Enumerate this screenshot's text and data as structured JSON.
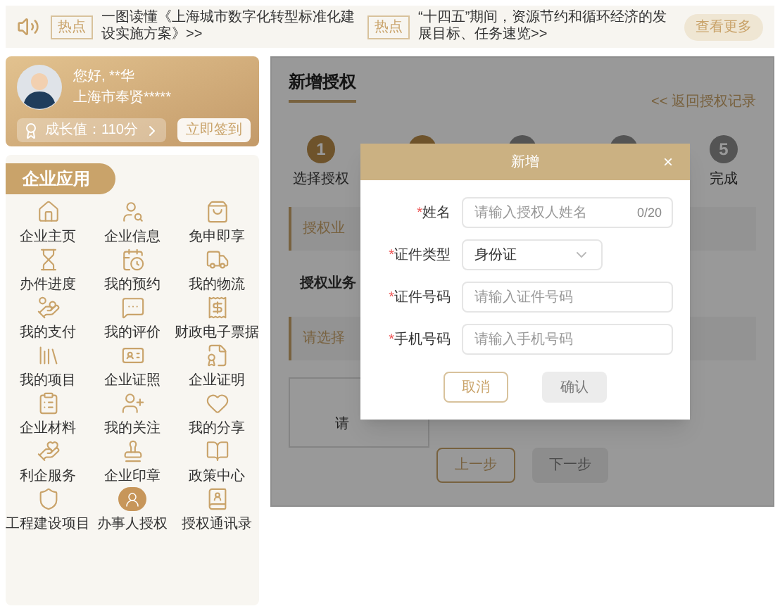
{
  "news_bar": {
    "items": [
      {
        "tag": "热点",
        "text": "一图读懂《上海城市数字化转型标准化建设实施方案》>>"
      },
      {
        "tag": "热点",
        "text": "“十四五”期间，资源节约和循环经济的发展目标、任务速览>>"
      }
    ],
    "more_button": "查看更多"
  },
  "profile": {
    "greeting": "您好, **华",
    "region": "上海市奉贤*****",
    "growth": "成长值：110分",
    "sign_in_button": "立即签到"
  },
  "apps": {
    "title": "企业应用",
    "items": [
      {
        "label": "企业主页",
        "selected": false
      },
      {
        "label": "企业信息",
        "selected": false
      },
      {
        "label": "免申即享",
        "selected": false
      },
      {
        "label": "办件进度",
        "selected": false
      },
      {
        "label": "我的预约",
        "selected": false
      },
      {
        "label": "我的物流",
        "selected": false
      },
      {
        "label": "我的支付",
        "selected": false
      },
      {
        "label": "我的评价",
        "selected": false
      },
      {
        "label": "财政电子票据",
        "selected": false
      },
      {
        "label": "我的项目",
        "selected": false
      },
      {
        "label": "企业证照",
        "selected": false
      },
      {
        "label": "企业证明",
        "selected": false
      },
      {
        "label": "企业材料",
        "selected": false
      },
      {
        "label": "我的关注",
        "selected": false
      },
      {
        "label": "我的分享",
        "selected": false
      },
      {
        "label": "利企服务",
        "selected": false
      },
      {
        "label": "企业印章",
        "selected": false
      },
      {
        "label": "政策中心",
        "selected": false
      },
      {
        "label": "工程建设项目",
        "selected": false
      },
      {
        "label": "办事人授权",
        "selected": true
      },
      {
        "label": "授权通讯录",
        "selected": false
      }
    ]
  },
  "main": {
    "title": "新增授权",
    "back_link": "<< 返回授权记录",
    "steps": [
      {
        "number": "1",
        "label": "选择授权",
        "active": true
      },
      {
        "active": true
      },
      {
        "active": false
      },
      {
        "active": false
      },
      {
        "number": "5",
        "label": "完成",
        "active": false
      }
    ],
    "section_1": "授权业",
    "field_label": "授权业务",
    "section_2": "请选择",
    "card_text": "请",
    "prev_button": "上一步",
    "next_button": "下一步"
  },
  "dialog": {
    "title": "新增",
    "close": "×",
    "fields": [
      {
        "kind": "text",
        "required_mark": "*",
        "label": "姓名",
        "placeholder": "请输入授权人姓名",
        "counter": "0/20"
      },
      {
        "kind": "select",
        "required_mark": "*",
        "label": "证件类型",
        "value": "身份证"
      },
      {
        "kind": "text",
        "required_mark": "*",
        "label": "证件号码",
        "placeholder": "请输入证件号码"
      },
      {
        "kind": "text",
        "required_mark": "*",
        "label": "手机号码",
        "placeholder": "请输入手机号码"
      }
    ],
    "cancel_button": "取消",
    "confirm_button": {
      "label": "确认",
      "disabled": true
    }
  }
}
